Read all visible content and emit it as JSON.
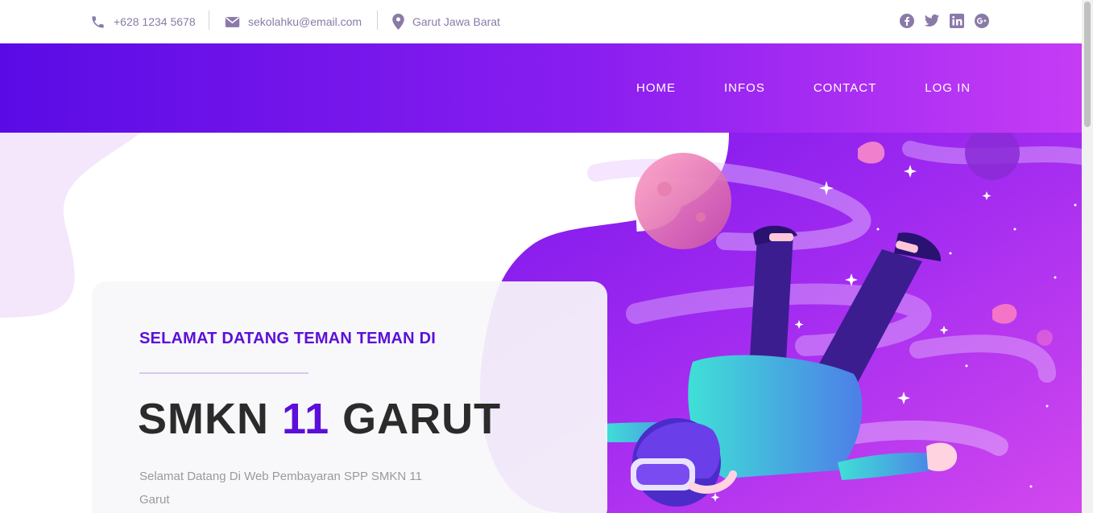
{
  "topbar": {
    "phone": "+628 1234 5678",
    "email": "sekolahku@email.com",
    "location": "Garut Jawa Barat",
    "social_icons": [
      "facebook-icon",
      "twitter-icon",
      "linkedin-icon",
      "google-plus-icon"
    ]
  },
  "nav": {
    "items": [
      "HOME",
      "INFOS",
      "CONTACT",
      "LOG IN"
    ]
  },
  "hero": {
    "eyebrow": "SELAMAT DATANG TEMAN TEMAN DI",
    "title_part1": "SMKN",
    "title_accent": "11",
    "title_part2": "GARUT",
    "description": "Selamat Datang Di Web Pembayaran SPP SMKN 11 Garut"
  },
  "colors": {
    "accent": "#5b0fd8",
    "header_start": "#5a0be5",
    "header_end": "#c63cf5",
    "muted_text": "#8a7aa8"
  }
}
